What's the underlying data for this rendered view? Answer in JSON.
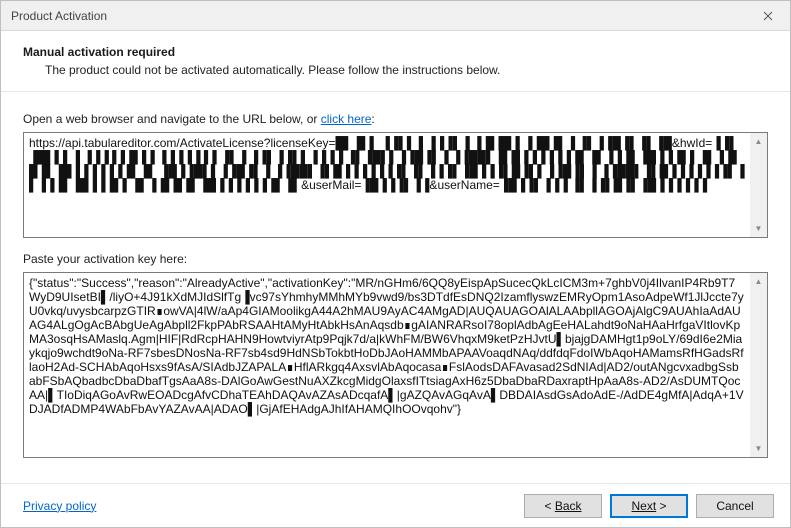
{
  "window": {
    "title": "Product Activation"
  },
  "header": {
    "title": "Manual activation required",
    "subtitle": "The product could not be activated automatically. Please follow the instructions below."
  },
  "urlSection": {
    "labelPrefix": "Open a web browser and navigate to the URL below, or ",
    "linkText": "click here",
    "labelSuffix": ":",
    "value": "https://api.tabulareditor.com/ActivateLicense?licenseKey=█▌▐▌▌ ▐▐▌▌ ▌▐▐▐▌▐ ▐▐▌█▌▌▐▐█▐▌▐ ▐▌▐▐█▐▌▐▌▐█&hwId=▐▐▌▐█▌▌▌▐ ▐▐▐ ▌▌█▐▐ ▐▐▐▐▐ ▌▌▐▌▐ ▐▐▌▐▐▌▌▐▐▐▐ ▐▌▐█▌▌▐▐█▐▌▐ ▐▐██▌▐▌█▐▐▐▐▐▐▐▌▐▌▐▐▐▌▐█▐▐▐▌▌▐▌▐▐▌█▐▌▐█▐▐▐▐▐▐▐▌▐▌ ▐█▐▐█▌▌▐▐█▐▌▐ ▐▐██▌▐▌█▐▐▐▐▐▐▐▌▐▌▐▐▐▌▐█▐▐▐▌█▐▌▌▐▐█▐▌▐ ▐▐██▌▐▌█▐▐▐▐▐▐▐▌▐▌▐▐▐▌▐█▐▐▐▌▌▐▌▐▐▌█▐▌▐█▐▐▐▐▐▐▐▌▐▌&userMail=▐█▐▐▐▌▐▐&userName=▐█▐▐▌▐▐▐ ▐▌▐▐▌█▐▌▐█▐▐▐▐▐▐"
  },
  "keySection": {
    "label": "Paste your activation key here:",
    "value": "{\"status\":\"Success\",\"reason\":\"AlreadyActive\",\"activationKey\":\"MR/nGHm6/6QQ8yEispApSucecQkLcICM3m+7ghbV0j4IlvanIP4Rb9T7WyD9UIsetBI▌/liyO+4J91kXdMJIdSlfTg▐vc97sYhmhyMMhMYb9vwd9/bs3DTdfEsDNQ2IzamflyswzEMRyOpm1AsoAdpeWf1JlJccte7yU0vkq/uvysbcarpzGTIR∎owVA|4lW/aAp4GIAMoolikgA44A2hMAU9AyAC4AMgAD|AUQAUAGOAlALAAbpllAGOAjAlgC9AUAhIaAdAUAG4ALgOgAcBAbgUeAgAbpll2FkpPAbRSAAHtAMyHtAbkHsAnAqsdb∎gAIANRARsoI78oplAdbAgEeHALahdt9oNaHAaHrfgaVItlovKpMA3osqHsAMaslq.Agm|HIF|RdRcpHAHN9HowtviyrAtp9Pqjk7d/a|kWhFM/BW6VhqxM9ketPzHJvtU▌bjajgDAMHgt1p9oLY/69dI6e2Miaykqjo9wchdt9oNa-RF7sbesDNosNa-RF7sb4sd9HdNSbTokbtHoDbJAoHAMMbAPAAVoaqdNAq/ddfdqFdoIWbAqoHAMamsRfHGadsRflaoH2Ad-SCHAbAqoHsxs9fAsA/SIAdbJZAPALA∎HflARkgq4AxsvlAbAqocasa∎FslAodsDAFAvasad2SdNIAd|AD2/outANgcvxadbgSsbabFSbAQbadbcDbaDbafTgsAaA8s-DAlGoAwGestNuAXZkcgMidgOlaxsfITtsiagAxH6z5DbaDbaRDaxraptHpAaA8s-AD2/AsDUMTQocAA|▌TIoDiqAGoAvRwEOADcgAfvCDhaTEAhDAQAvAZAsADcqafA▌|gAZQAvAGqAvA▌DBDAIAsdGsAdoAdE-/AdDE4gMfA|AdqA+1VDJADfADMP4WAbFbAvYAZAvAA|ADAO▌|GjAfEHAdgAJhIfAHAMQIhOOvqohv\"}"
  },
  "footer": {
    "privacy": "Privacy policy",
    "back": "Back",
    "next": "Next",
    "cancel": "Cancel"
  }
}
